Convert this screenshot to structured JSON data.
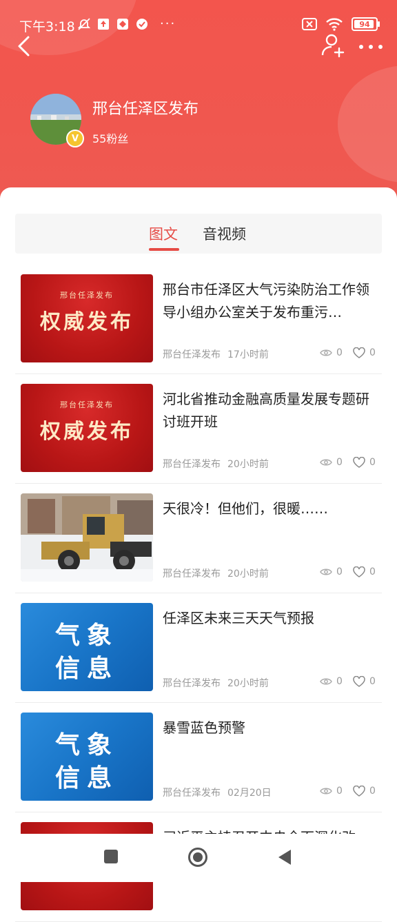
{
  "status": {
    "time": "下午3:18",
    "battery": "94",
    "more_dots": "···"
  },
  "profile": {
    "name": "邢台任泽区发布",
    "followers": "55粉丝",
    "verified_badge": "V"
  },
  "tabs": [
    {
      "label": "图文",
      "active": true
    },
    {
      "label": "音视频",
      "active": false
    }
  ],
  "articles": [
    {
      "title": "邢台市任泽区大气污染防治工作领导小组办公室关于发布重污…",
      "source": "邢台任泽发布",
      "time": "17小时前",
      "views": "0",
      "likes": "0",
      "thumb": {
        "kind": "red",
        "small": "邢台任泽发布",
        "big": "权威发布"
      }
    },
    {
      "title": "河北省推动金融高质量发展专题研讨班开班",
      "source": "邢台任泽发布",
      "time": "20小时前",
      "views": "0",
      "likes": "0",
      "thumb": {
        "kind": "red",
        "small": "邢台任泽发布",
        "big": "权威发布"
      }
    },
    {
      "title": "天很冷！但他们，很暖……",
      "source": "邢台任泽发布",
      "time": "20小时前",
      "views": "0",
      "likes": "0",
      "thumb": {
        "kind": "photo",
        "description": "snow-loader-photo"
      }
    },
    {
      "title": "任泽区未来三天天气预报",
      "source": "邢台任泽发布",
      "time": "20小时前",
      "views": "0",
      "likes": "0",
      "thumb": {
        "kind": "blue",
        "line1": "气象",
        "line2": "信息"
      }
    },
    {
      "title": "暴雪蓝色预警",
      "source": "邢台任泽发布",
      "time": "02月20日",
      "views": "0",
      "likes": "0",
      "thumb": {
        "kind": "blue",
        "line1": "气象",
        "line2": "信息"
      }
    },
    {
      "title": "习近平主持召开中央全面深化改",
      "source": "",
      "time": "",
      "views": "",
      "likes": "",
      "thumb": {
        "kind": "red",
        "small": "",
        "big": ""
      }
    }
  ],
  "colors": {
    "header": "#f3554d",
    "accent": "#e64b45",
    "text": "#222222",
    "meta": "#999999"
  },
  "icons": {
    "back": "chevron-left-icon",
    "follow": "user-plus-icon",
    "more": "more-dots-icon",
    "views": "eye-icon",
    "likes": "heart-icon"
  }
}
